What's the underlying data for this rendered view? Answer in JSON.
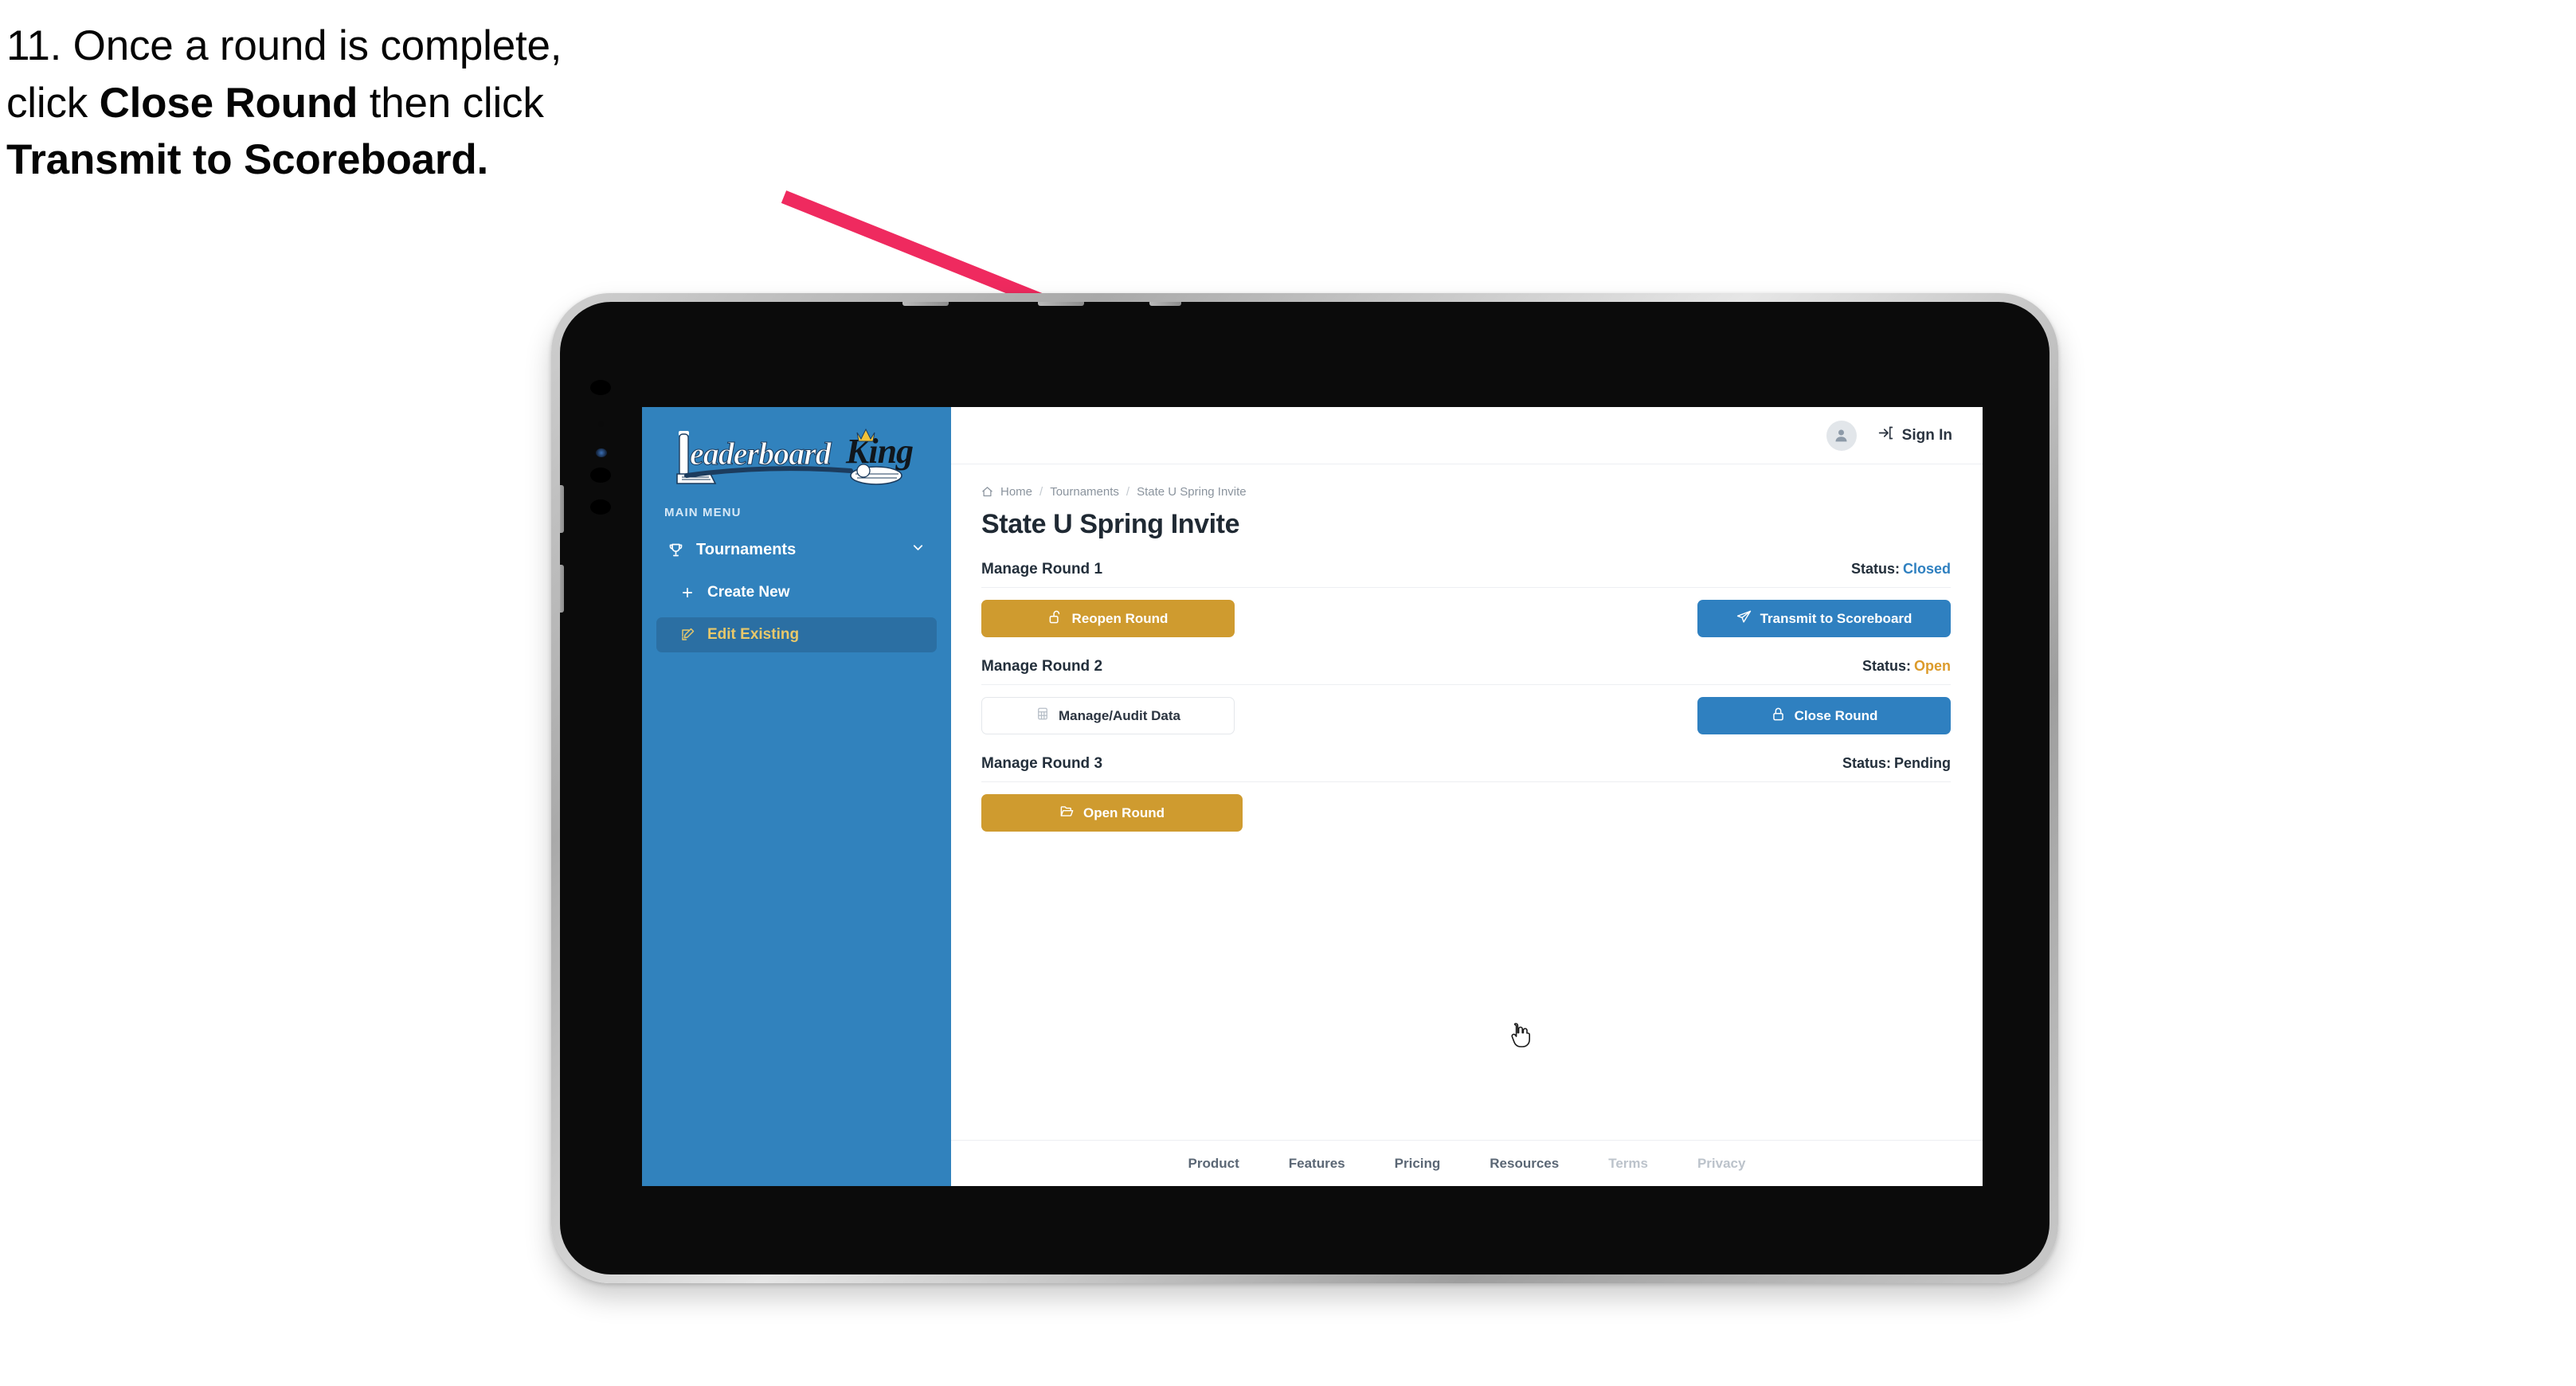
{
  "instruction": {
    "number": "11.",
    "line1_a": "11. Once a round is complete,",
    "line2_a": "click ",
    "line2_b": "Close Round",
    "line2_c": " then click",
    "line3_b": "Transmit to Scoreboard."
  },
  "colors": {
    "sidebar_blue": "#3182bd",
    "sidebar_active": "#2b6fa3",
    "active_text_gold": "#e8c86a",
    "btn_gold": "#cf9b2f",
    "btn_blue": "#2f80c0",
    "status_closed": "#2f80c0",
    "status_open": "#dc9b2b",
    "status_pending": "#232f3b",
    "arrow_pink": "#ef2a5f"
  },
  "sidebar": {
    "logo_text_a": "Leaderboard",
    "logo_text_b": "King",
    "menu_label": "MAIN MENU",
    "items": [
      {
        "label": "Tournaments",
        "icon": "trophy-icon",
        "chevron": "chevron-down-icon",
        "active": false
      },
      {
        "label": "Create New",
        "icon": "plus-icon",
        "active": false
      },
      {
        "label": "Edit Existing",
        "icon": "edit-pencil-icon",
        "active": true
      }
    ]
  },
  "topbar": {
    "avatar_icon": "user-avatar-icon",
    "signin_icon": "sign-in-arrow-icon",
    "signin_label": "Sign In"
  },
  "breadcrumb": {
    "home_icon": "home-icon",
    "items": [
      "Home",
      "Tournaments",
      "State U Spring Invite"
    ],
    "separator": "/"
  },
  "page": {
    "title": "State U Spring Invite"
  },
  "rounds": [
    {
      "title": "Manage Round 1",
      "status_label": "Status:",
      "status_value": "Closed",
      "status_color": "#2f80c0",
      "left_button": {
        "label": "Reopen Round",
        "icon": "unlock-icon",
        "style": "gold"
      },
      "right_button": {
        "label": "Transmit to Scoreboard",
        "icon": "paper-plane-icon",
        "style": "blue"
      }
    },
    {
      "title": "Manage Round 2",
      "status_label": "Status:",
      "status_value": "Open",
      "status_color": "#dc9b2b",
      "left_button": {
        "label": "Manage/Audit Data",
        "icon": "table-grid-icon",
        "style": "ghost"
      },
      "right_button": {
        "label": "Close Round",
        "icon": "lock-icon",
        "style": "blue"
      }
    },
    {
      "title": "Manage Round 3",
      "status_label": "Status:",
      "status_value": "Pending",
      "status_color": "#232f3b",
      "left_button": {
        "label": "Open Round",
        "icon": "open-folder-icon",
        "style": "gold"
      },
      "right_button": null
    }
  ],
  "footer": {
    "links": [
      {
        "label": "Product",
        "muted": false
      },
      {
        "label": "Features",
        "muted": false
      },
      {
        "label": "Pricing",
        "muted": false
      },
      {
        "label": "Resources",
        "muted": false
      },
      {
        "label": "Terms",
        "muted": true
      },
      {
        "label": "Privacy",
        "muted": true
      }
    ]
  },
  "cursor": {
    "icon": "pointing-hand-cursor"
  }
}
